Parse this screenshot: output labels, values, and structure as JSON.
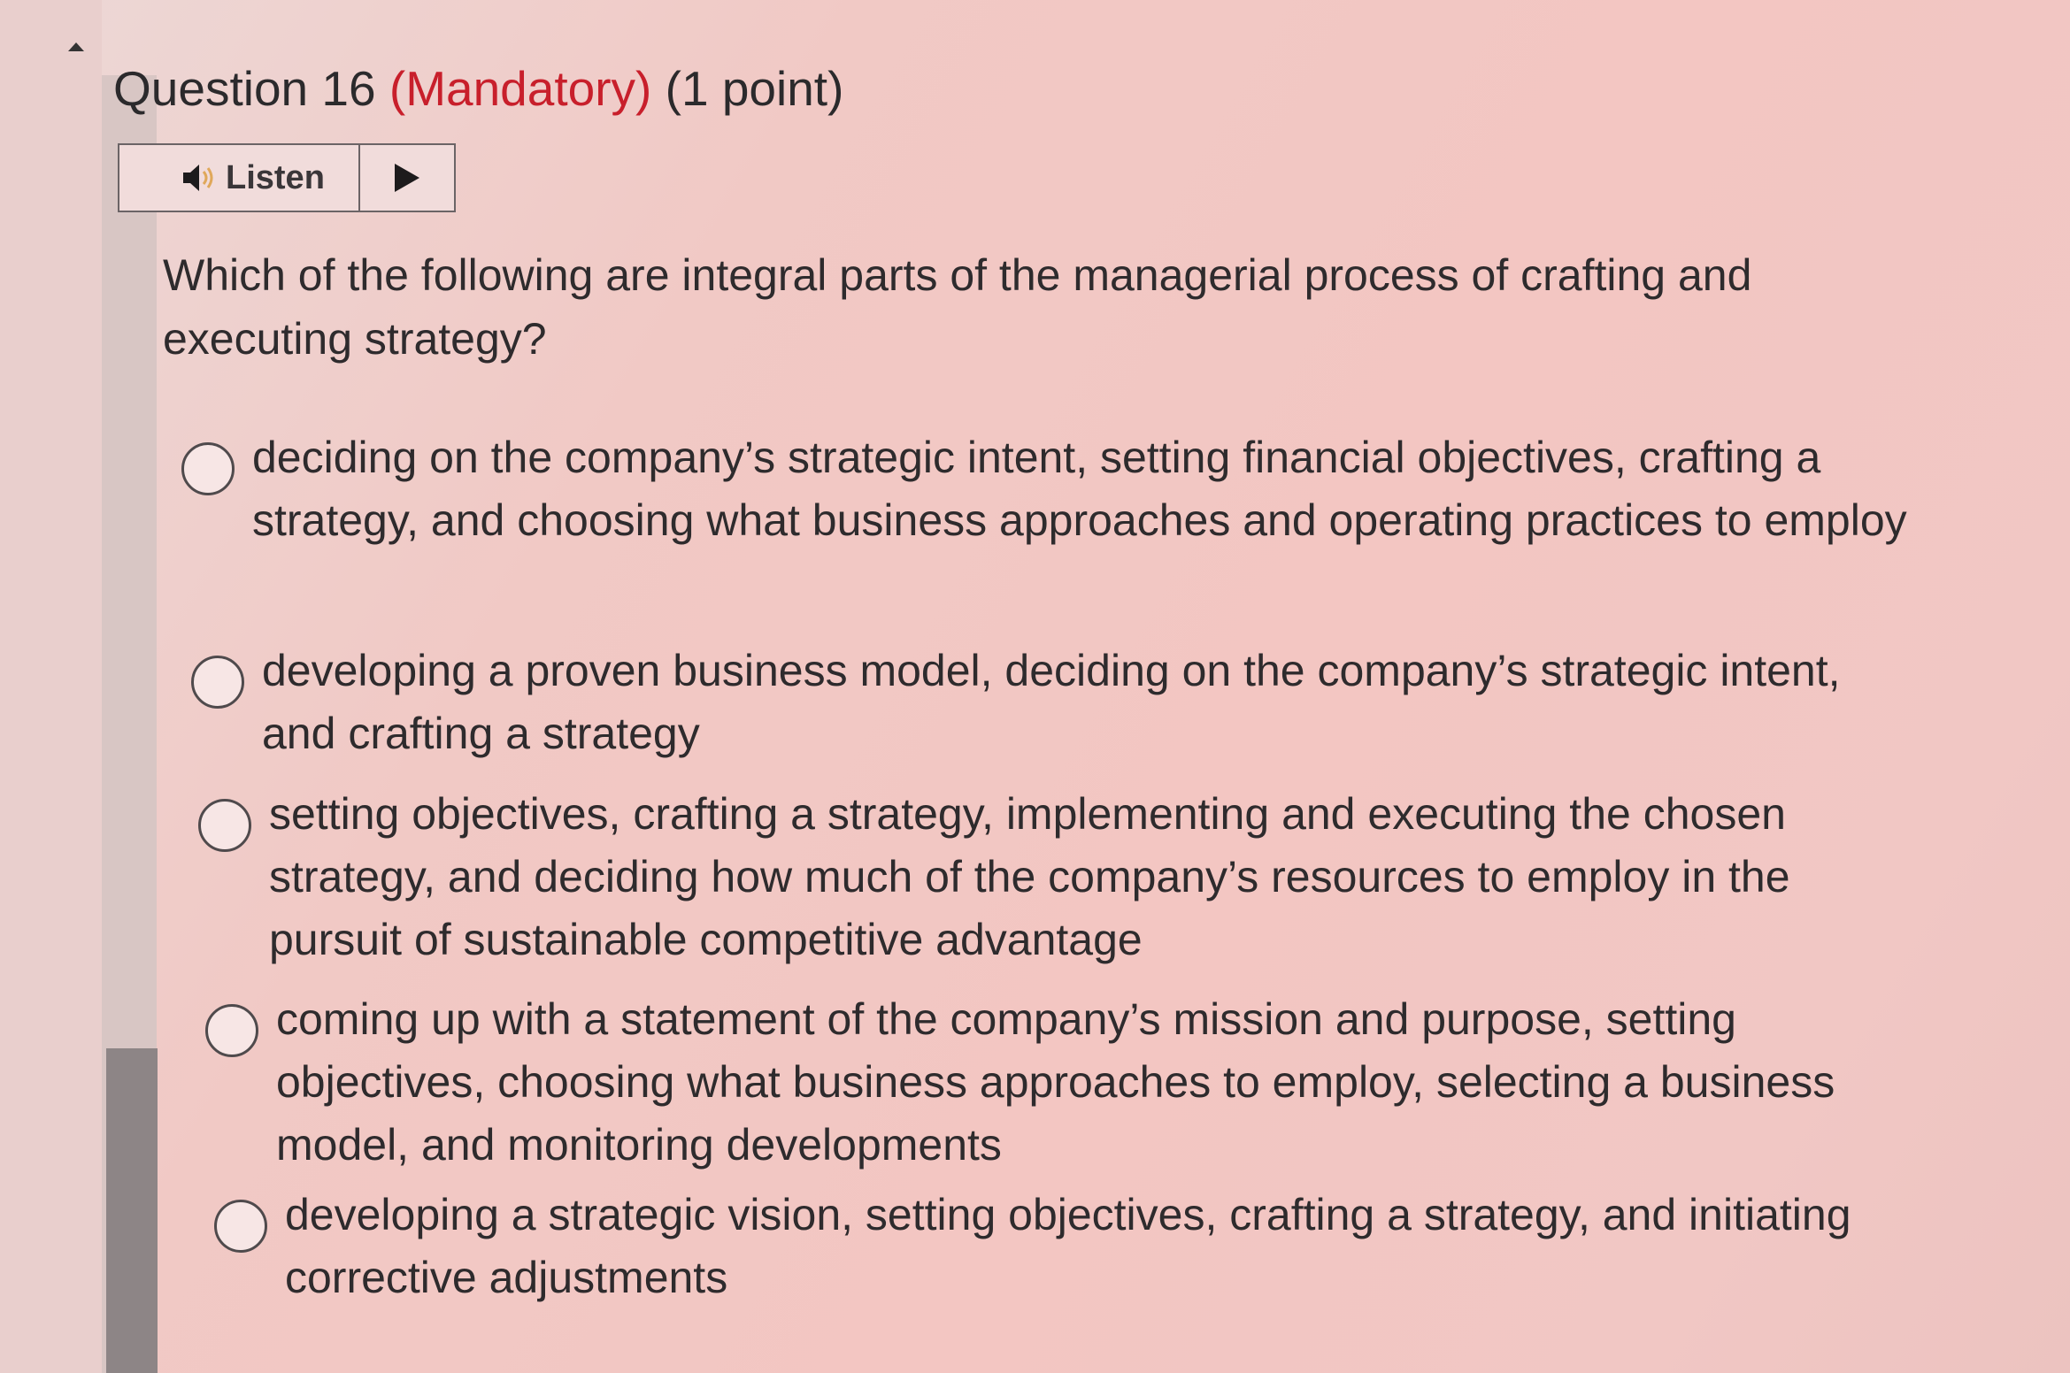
{
  "question": {
    "number_label": "Question 16",
    "mandatory_label": "(Mandatory)",
    "points_label": "(1 point)"
  },
  "listen": {
    "label": "Listen",
    "speaker_icon": "speaker-icon",
    "play_icon": "play-icon"
  },
  "prompt": "Which of the following are integral parts of the managerial process of crafting and executing strategy?",
  "options": [
    {
      "text": "deciding on the company’s strategic intent, setting financial objectives, crafting a strategy, and choosing what business approaches and operating practices to employ",
      "selected": false
    },
    {
      "text": "developing a proven business model, deciding on the company’s strategic intent, and crafting a strategy",
      "selected": false
    },
    {
      "text": "setting objectives, crafting a strategy, implementing and executing the chosen strategy, and deciding how much of the company’s resources to employ in the pursuit of sustainable competitive advantage",
      "selected": false
    },
    {
      "text": "coming up with a statement of the company’s mission and purpose, setting objectives, choosing what business approaches to employ, selecting a business model, and monitoring developments",
      "selected": false
    },
    {
      "text": "developing a strategic vision, setting objectives, crafting a strategy, and initiating corrective adjustments",
      "selected": false
    }
  ],
  "colors": {
    "mandatory": "#c81f2b",
    "text": "#2e2b2d",
    "background": "#f3c6c2"
  }
}
